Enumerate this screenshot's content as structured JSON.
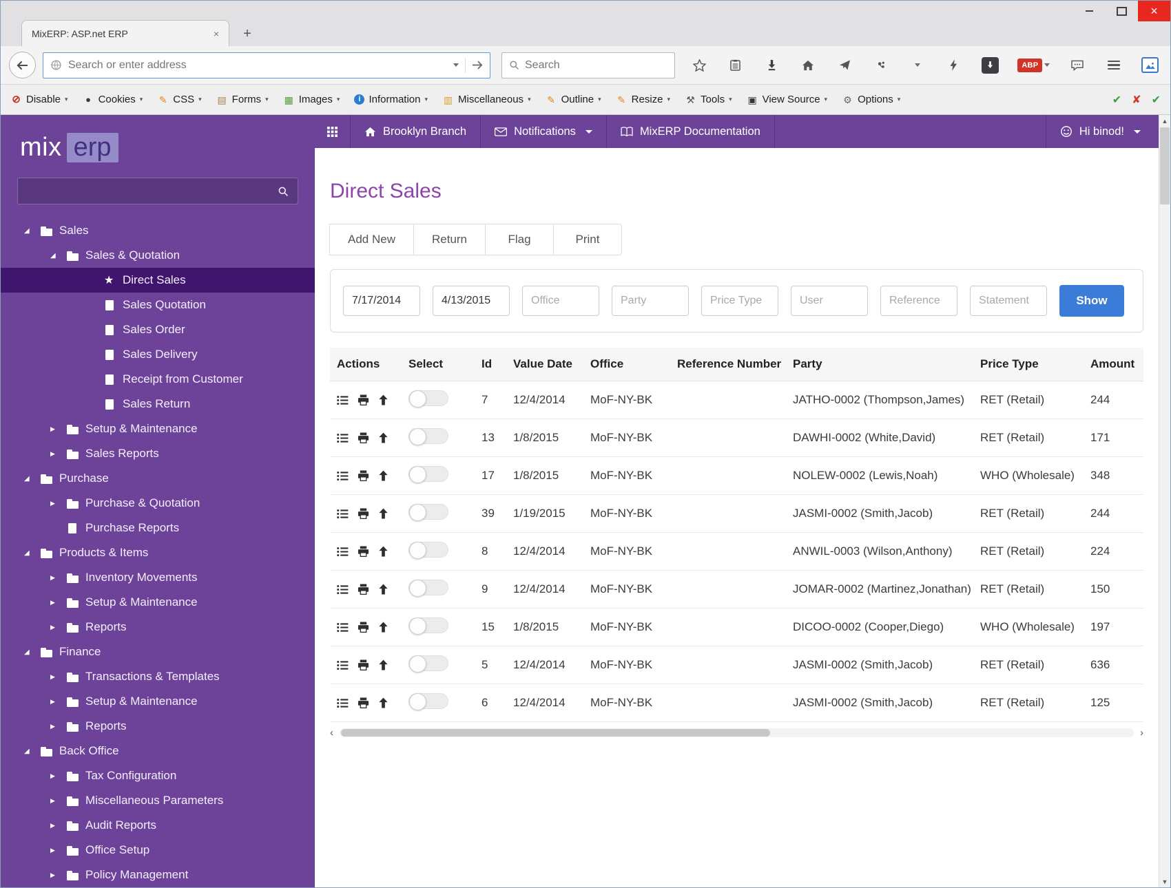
{
  "window": {
    "tab_title": "MixERP: ASP.net ERP",
    "tab_close": "×",
    "new_tab": "+"
  },
  "browser": {
    "address_placeholder": "Search or enter address",
    "search_placeholder": "Search",
    "adblock_label": "ABP"
  },
  "devbar": {
    "items": [
      {
        "label": "Disable",
        "icon": "disable-icon",
        "glyph": "⊘"
      },
      {
        "label": "Cookies",
        "icon": "cookies-icon",
        "glyph": "●"
      },
      {
        "label": "CSS",
        "icon": "css-icon",
        "glyph": "✎"
      },
      {
        "label": "Forms",
        "icon": "forms-icon",
        "glyph": "▤"
      },
      {
        "label": "Images",
        "icon": "images-icon",
        "glyph": "▦"
      },
      {
        "label": "Information",
        "icon": "information-icon",
        "glyph": "i"
      },
      {
        "label": "Miscellaneous",
        "icon": "misc-icon",
        "glyph": "▥"
      },
      {
        "label": "Outline",
        "icon": "outline-icon",
        "glyph": "✎"
      },
      {
        "label": "Resize",
        "icon": "resize-icon",
        "glyph": "✎"
      },
      {
        "label": "Tools",
        "icon": "tools-icon",
        "glyph": "⚒"
      },
      {
        "label": "View Source",
        "icon": "viewsource-icon",
        "glyph": "▣"
      },
      {
        "label": "Options",
        "icon": "options-icon",
        "glyph": "⚙"
      }
    ],
    "status": [
      {
        "icon": "pass-icon",
        "glyph": "✔"
      },
      {
        "icon": "fail-icon",
        "glyph": "✘"
      },
      {
        "icon": "pass-icon",
        "glyph": "✔"
      }
    ]
  },
  "appnav": {
    "branch": "Brooklyn Branch",
    "notifications": "Notifications",
    "documentation": "MixERP Documentation",
    "greeting": "Hi binod!"
  },
  "sidebar": {
    "logo_mix": "mix",
    "logo_erp": "erp",
    "tree": [
      {
        "label": "Sales",
        "level": "lvl1",
        "marker": "expanded",
        "icon": "folder-icon"
      },
      {
        "label": "Sales & Quotation",
        "level": "lvl2",
        "marker": "expanded",
        "icon": "folder-icon"
      },
      {
        "label": "Direct Sales",
        "level": "lvl3",
        "marker": "leaf",
        "icon": "star-icon",
        "state": "selected"
      },
      {
        "label": "Sales Quotation",
        "level": "lvl3",
        "marker": "leaf",
        "icon": "file-icon"
      },
      {
        "label": "Sales Order",
        "level": "lvl3",
        "marker": "leaf",
        "icon": "file-icon"
      },
      {
        "label": "Sales Delivery",
        "level": "lvl3",
        "marker": "leaf",
        "icon": "file-icon"
      },
      {
        "label": "Receipt from Customer",
        "level": "lvl3",
        "marker": "leaf",
        "icon": "file-icon"
      },
      {
        "label": "Sales Return",
        "level": "lvl3",
        "marker": "leaf",
        "icon": "file-icon"
      },
      {
        "label": "Setup & Maintenance",
        "level": "lvl2",
        "marker": "collapsed",
        "icon": "folder-icon"
      },
      {
        "label": "Sales Reports",
        "level": "lvl2",
        "marker": "collapsed",
        "icon": "folder-icon"
      },
      {
        "label": "Purchase",
        "level": "lvl1",
        "marker": "expanded",
        "icon": "folder-icon"
      },
      {
        "label": "Purchase & Quotation",
        "level": "lvl2",
        "marker": "collapsed",
        "icon": "folder-icon"
      },
      {
        "label": "Purchase Reports",
        "level": "lvl2",
        "marker": "leaf",
        "icon": "file-icon"
      },
      {
        "label": "Products & Items",
        "level": "lvl1",
        "marker": "expanded",
        "icon": "folder-icon"
      },
      {
        "label": "Inventory Movements",
        "level": "lvl2",
        "marker": "collapsed",
        "icon": "folder-icon"
      },
      {
        "label": "Setup & Maintenance",
        "level": "lvl2",
        "marker": "collapsed",
        "icon": "folder-icon"
      },
      {
        "label": "Reports",
        "level": "lvl2",
        "marker": "collapsed",
        "icon": "folder-icon"
      },
      {
        "label": "Finance",
        "level": "lvl1",
        "marker": "expanded",
        "icon": "folder-icon"
      },
      {
        "label": "Transactions & Templates",
        "level": "lvl2",
        "marker": "collapsed",
        "icon": "folder-icon"
      },
      {
        "label": "Setup & Maintenance",
        "level": "lvl2",
        "marker": "collapsed",
        "icon": "folder-icon"
      },
      {
        "label": "Reports",
        "level": "lvl2",
        "marker": "collapsed",
        "icon": "folder-icon"
      },
      {
        "label": "Back Office",
        "level": "lvl1",
        "marker": "expanded",
        "icon": "folder-icon"
      },
      {
        "label": "Tax Configuration",
        "level": "lvl2",
        "marker": "collapsed",
        "icon": "folder-icon"
      },
      {
        "label": "Miscellaneous Parameters",
        "level": "lvl2",
        "marker": "collapsed",
        "icon": "folder-icon"
      },
      {
        "label": "Audit Reports",
        "level": "lvl2",
        "marker": "collapsed",
        "icon": "folder-icon"
      },
      {
        "label": "Office Setup",
        "level": "lvl2",
        "marker": "collapsed",
        "icon": "folder-icon"
      },
      {
        "label": "Policy Management",
        "level": "lvl2",
        "marker": "collapsed",
        "icon": "folder-icon"
      }
    ]
  },
  "main": {
    "title": "Direct Sales",
    "buttons": [
      "Add New",
      "Return",
      "Flag",
      "Print"
    ],
    "filters": {
      "from_value": "7/17/2014",
      "to_value": "4/13/2015",
      "office_placeholder": "Office",
      "party_placeholder": "Party",
      "price_type_placeholder": "Price Type",
      "user_placeholder": "User",
      "reference_placeholder": "Reference",
      "statement_placeholder": "Statement",
      "show_label": "Show"
    },
    "table": {
      "headers": [
        "Actions",
        "Select",
        "Id",
        "Value Date",
        "Office",
        "Reference Number",
        "Party",
        "Price Type",
        "Amount"
      ],
      "rows": [
        {
          "id": "7",
          "value_date": "12/4/2014",
          "office": "MoF-NY-BK",
          "reference_number": "",
          "party": "JATHO-0002 (Thompson,James)",
          "price_type": "RET (Retail)",
          "amount": "244"
        },
        {
          "id": "13",
          "value_date": "1/8/2015",
          "office": "MoF-NY-BK",
          "reference_number": "",
          "party": "DAWHI-0002 (White,David)",
          "price_type": "RET (Retail)",
          "amount": "171"
        },
        {
          "id": "17",
          "value_date": "1/8/2015",
          "office": "MoF-NY-BK",
          "reference_number": "",
          "party": "NOLEW-0002 (Lewis,Noah)",
          "price_type": "WHO (Wholesale)",
          "amount": "348"
        },
        {
          "id": "39",
          "value_date": "1/19/2015",
          "office": "MoF-NY-BK",
          "reference_number": "",
          "party": "JASMI-0002 (Smith,Jacob)",
          "price_type": "RET (Retail)",
          "amount": "244"
        },
        {
          "id": "8",
          "value_date": "12/4/2014",
          "office": "MoF-NY-BK",
          "reference_number": "",
          "party": "ANWIL-0003 (Wilson,Anthony)",
          "price_type": "RET (Retail)",
          "amount": "224"
        },
        {
          "id": "9",
          "value_date": "12/4/2014",
          "office": "MoF-NY-BK",
          "reference_number": "",
          "party": "JOMAR-0002 (Martinez,Jonathan)",
          "price_type": "RET (Retail)",
          "amount": "150"
        },
        {
          "id": "15",
          "value_date": "1/8/2015",
          "office": "MoF-NY-BK",
          "reference_number": "",
          "party": "DICOO-0002 (Cooper,Diego)",
          "price_type": "WHO (Wholesale)",
          "amount": "197"
        },
        {
          "id": "5",
          "value_date": "12/4/2014",
          "office": "MoF-NY-BK",
          "reference_number": "",
          "party": "JASMI-0002 (Smith,Jacob)",
          "price_type": "RET (Retail)",
          "amount": "636"
        },
        {
          "id": "6",
          "value_date": "12/4/2014",
          "office": "MoF-NY-BK",
          "reference_number": "",
          "party": "JASMI-0002 (Smith,Jacob)",
          "price_type": "RET (Retail)",
          "amount": "125"
        }
      ]
    }
  }
}
